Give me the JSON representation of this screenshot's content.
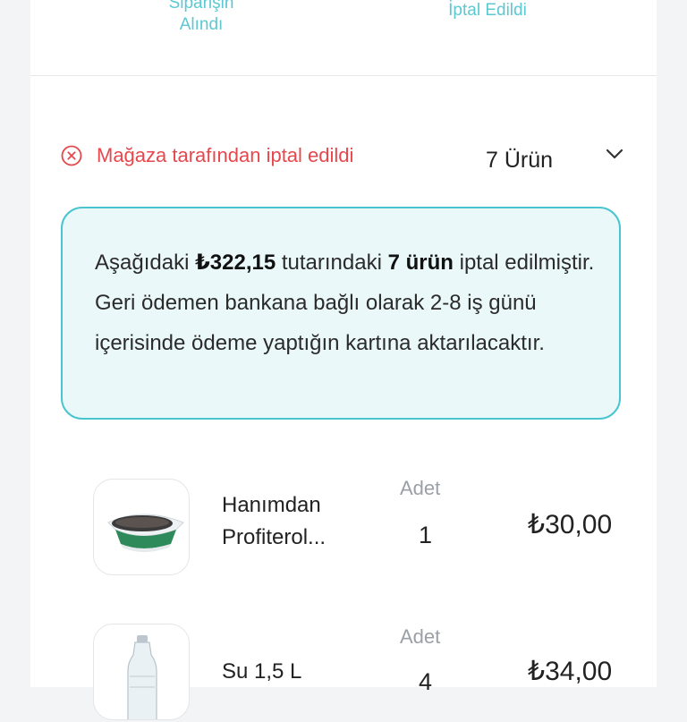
{
  "steps": {
    "received": "Siparişin\nAlındı",
    "cancelled": "İptal Edildi"
  },
  "status": {
    "text": "Mağaza tarafından iptal edildi",
    "item_count": "7 Ürün",
    "color": "#e5484d"
  },
  "notice": {
    "part1": "Aşağıdaki ",
    "amount": "₺322,15",
    "part2": " tutarındaki ",
    "count": "7 ürün",
    "part3": " iptal edilmiştir. Geri ödemen bankana bağlı olarak 2-8 iş günü içerisinde ödeme yaptığın kartına aktarılacaktır."
  },
  "items": [
    {
      "name": "Hanımdan Profiterol...",
      "qty_label": "Adet",
      "qty": "1",
      "price": "₺30,00",
      "icon": "dessert-bowl-image"
    },
    {
      "name": "Su 1,5 L",
      "qty_label": "Adet",
      "qty": "4",
      "price": "₺34,00",
      "icon": "water-bottle-image"
    }
  ],
  "colors": {
    "accent": "#49c5d0",
    "notice_bg": "#eaf8fa"
  }
}
